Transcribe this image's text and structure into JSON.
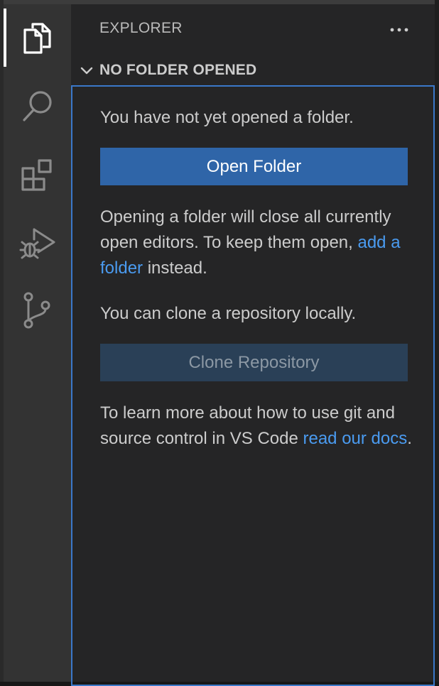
{
  "sidebar": {
    "title": "EXPLORER",
    "more_actions_icon": "ellipsis-icon"
  },
  "activity_bar": {
    "items": [
      {
        "icon": "explorer-icon",
        "active": true
      },
      {
        "icon": "search-icon",
        "active": false
      },
      {
        "icon": "extensions-icon",
        "active": false
      },
      {
        "icon": "run-debug-icon",
        "active": false
      },
      {
        "icon": "source-control-icon",
        "active": false
      }
    ]
  },
  "section": {
    "title": "NO FOLDER OPENED",
    "expanded": true,
    "intro": "You have not yet opened a folder.",
    "open_folder_label": "Open Folder",
    "warning_prefix": "Opening a folder will close all currently open editors. To keep them open, ",
    "add_folder_link": "add a folder",
    "warning_suffix": " instead.",
    "clone_intro": "You can clone a repository locally.",
    "clone_label": "Clone Repository",
    "learn_prefix": "To learn more about how to use git and source control in VS Code ",
    "docs_link": "read our docs",
    "learn_suffix": "."
  },
  "colors": {
    "accent": "#2f65a8",
    "link": "#4a9bf0",
    "focus_border": "#3a78c9"
  }
}
